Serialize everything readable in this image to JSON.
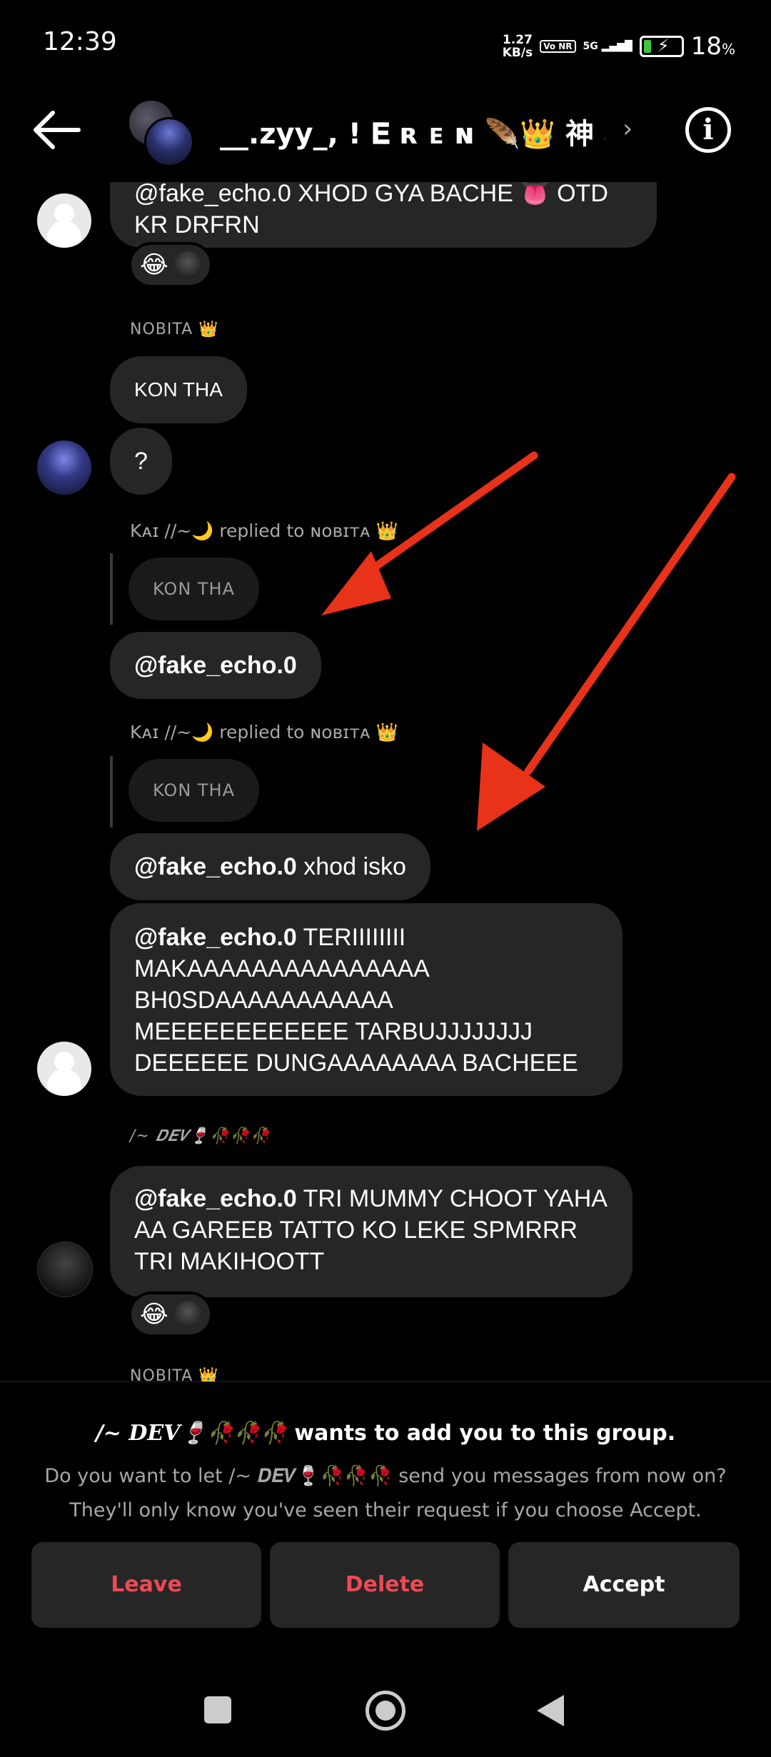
{
  "status_bar": {
    "time": "12:39",
    "net_speed_value": "1.27",
    "net_speed_unit": "KB/s",
    "volte": "Vo NR",
    "network": "5G",
    "battery_pct": "18",
    "battery_unit": "%"
  },
  "header": {
    "group_name": "__.zyy_, ! 𝐄 ʀ ᴇ ɴ 🪶👑 神 an..."
  },
  "messages": {
    "m1_text": "@fake_echo.0 XHOD GYA BACHE 👅 OTD KR DRFRN",
    "m1_reaction": "😂",
    "nobita_sender": "NOBITA 👑",
    "kon_tha": "KON THA",
    "question": "?",
    "reply1_meta": "Kᴀɪ //~🌙 replied to ɴᴏʙɪᴛᴀ 👑",
    "reply1_quote": "KON THA",
    "reply1_mention": "@fake_echo.0",
    "reply2_meta": "Kᴀɪ //~🌙 replied to ɴᴏʙɪᴛᴀ 👑",
    "reply2_quote": "KON THA",
    "reply2_mention": "@fake_echo.0",
    "reply2_text": " xhod isko",
    "long_mention": "@fake_echo.0",
    "long_text": " TERIIIIIIII MAKAAAAAAAAAAAAAAA BH0SDAAAAAAAAAAA MEEEEEEEEEEEE TARBUJJJJJJJJ DEEEEEE DUNGAAAAAAAA BACHEEE",
    "dev_sender": "/~ 𝑫𝑬𝑽🍷🥀🥀🥀",
    "dev_mention": "@fake_echo.0",
    "dev_text": " TRI MUMMY CHOOT YAHA AA GAREEB TATTO KO LEKE SPMRRR TRI MAKIHOOTT",
    "dev_reaction": "😂",
    "nobita_sender_2": "NOBITA 👑"
  },
  "request_panel": {
    "title_name": "/~ 𝑫𝑬𝑽🍷🥀🥀🥀",
    "title_suffix": " wants to add you to this group.",
    "description": "Do you want to let /~ 𝑫𝑬𝑽🍷🥀🥀🥀 send you messages from now on? They'll only know you've seen their request if you choose Accept.",
    "leave": "Leave",
    "delete": "Delete",
    "accept": "Accept"
  },
  "colors": {
    "background": "#000000",
    "bubble": "#262626",
    "danger": "#ed4956",
    "annotation_arrow": "#e8321a"
  }
}
